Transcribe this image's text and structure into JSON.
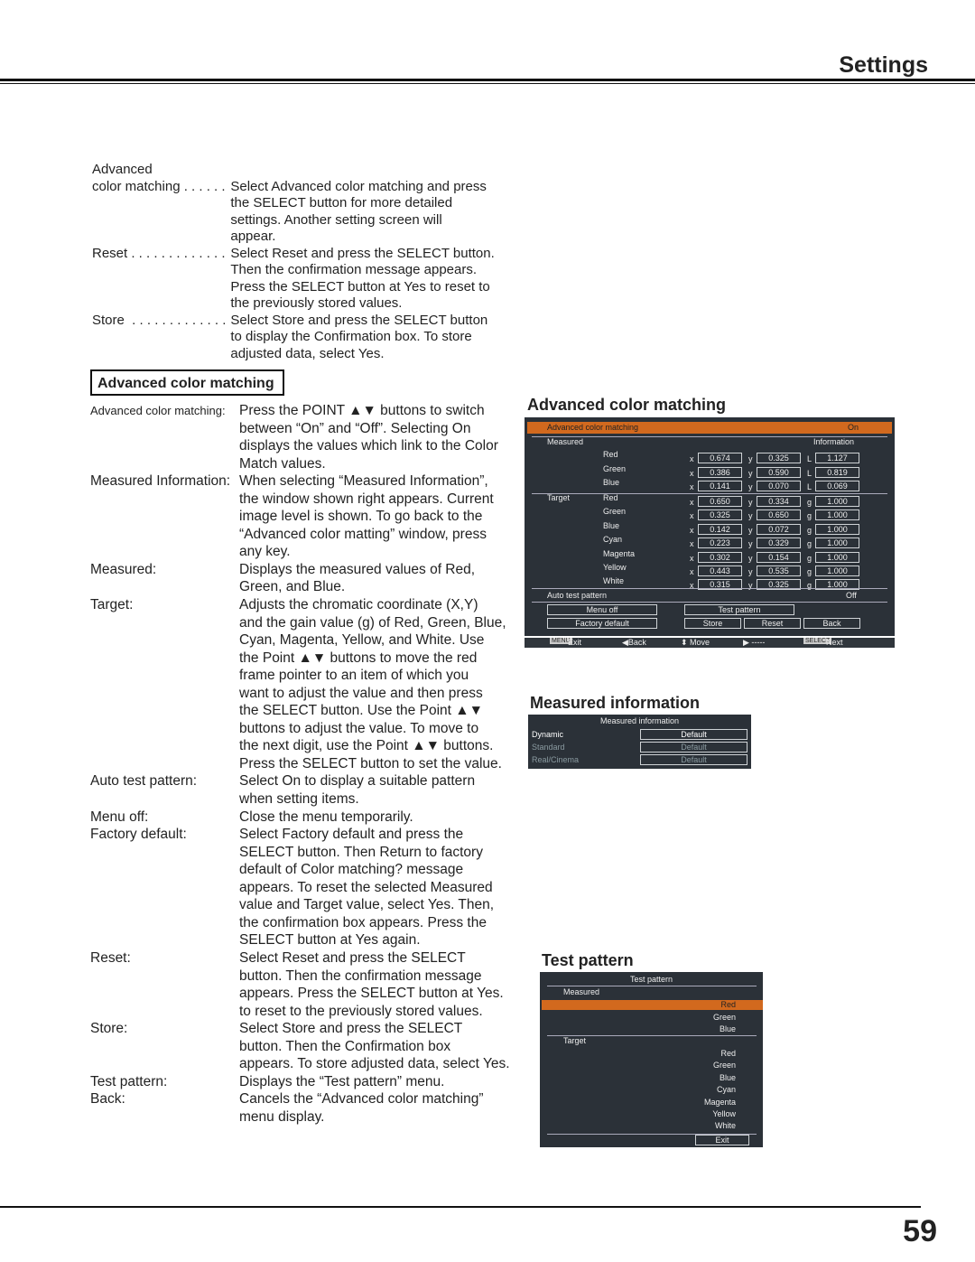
{
  "header": {
    "title": "Settings"
  },
  "top_definitions": [
    {
      "term": "Advanced",
      "lines": [
        ""
      ]
    },
    {
      "term": "color matching . . . . . .",
      "lines": [
        "Select Advanced color matching and press",
        "the SELECT button for more detailed",
        "settings. Another setting screen will",
        "appear."
      ]
    },
    {
      "term": "Reset . . . . . . . . . . . . .",
      "lines": [
        "Select Reset and press the SELECT button.",
        "Then the confirmation message appears.",
        "Press the SELECT button at Yes to reset to",
        "the previously stored values."
      ]
    },
    {
      "term": "Store  . . . . . . . . . . . . .",
      "lines": [
        "Select Store and press the SELECT button",
        "to display the Confirmation box. To store",
        "adjusted data, select Yes."
      ]
    }
  ],
  "section_title": "Advanced color matching",
  "definitions": [
    {
      "term": "Advanced color matching:",
      "small": true,
      "lines": [
        "Press the POINT ▲▼ buttons to switch",
        "between “On” and “Off”. Selecting On",
        "displays the values which link to the Color",
        "Match values."
      ]
    },
    {
      "term": "Measured Information:",
      "lines": [
        "When selecting “Measured Information”,",
        "the window shown right appears. Current",
        "image level is shown. To go back to the",
        "“Advanced color matting” window, press",
        "any key."
      ]
    },
    {
      "term": "Measured:",
      "lines": [
        "Displays the measured values of Red,",
        "Green, and Blue."
      ]
    },
    {
      "term": "Target:",
      "lines": [
        "Adjusts the chromatic coordinate (X,Y)",
        "and the gain value (g) of Red, Green, Blue,",
        "Cyan, Magenta, Yellow, and White. Use",
        "the Point ▲▼ buttons to move the red",
        "frame pointer to an item of which you",
        "want to adjust the value and then press",
        "the SELECT button. Use the Point ▲▼",
        "buttons to adjust the value. To move to",
        "the next digit, use the Point ▲▼ buttons.",
        "Press the SELECT button to set the value."
      ]
    },
    {
      "term": "Auto test pattern:",
      "lines": [
        "Select On to display a suitable pattern",
        "when setting items."
      ]
    },
    {
      "term": "Menu off:",
      "lines": [
        "Close the menu temporarily."
      ]
    },
    {
      "term": "Factory default:",
      "lines": [
        "Select Factory default and press the",
        "SELECT button. Then Return to factory",
        "default of Color matching? message",
        "appears. To reset the selected Measured",
        "value and Target value, select Yes. Then,",
        "the confirmation box appears. Press the",
        "SELECT button at Yes again."
      ]
    },
    {
      "term": "Reset:",
      "lines": [
        "Select Reset and press the SELECT",
        "button. Then the confirmation message",
        "appears. Press the SELECT button at Yes.",
        "to reset to the previously stored values."
      ]
    },
    {
      "term": "Store:",
      "lines": [
        "Select Store and press the SELECT",
        "button. Then the Confirmation box",
        "appears. To store adjusted data, select Yes."
      ]
    },
    {
      "term": "Test pattern:",
      "lines": [
        "Displays the “Test pattern” menu."
      ]
    },
    {
      "term": "Back:",
      "lines": [
        "Cancels the “Advanced color matching”",
        "menu display."
      ]
    }
  ],
  "acm_panel": {
    "heading": "Advanced color matching",
    "title": "Advanced color matching",
    "title_value": "On",
    "measured_label": "Measured",
    "information_label": "Information",
    "target_label": "Target",
    "measured": [
      {
        "name": "Red",
        "x": "0.674",
        "y": "0.325",
        "k": "L",
        "v": "1.127"
      },
      {
        "name": "Green",
        "x": "0.386",
        "y": "0.590",
        "k": "L",
        "v": "0.819"
      },
      {
        "name": "Blue",
        "x": "0.141",
        "y": "0.070",
        "k": "L",
        "v": "0.069"
      }
    ],
    "target": [
      {
        "name": "Red",
        "x": "0.650",
        "y": "0.334",
        "k": "g",
        "v": "1.000"
      },
      {
        "name": "Green",
        "x": "0.325",
        "y": "0.650",
        "k": "g",
        "v": "1.000"
      },
      {
        "name": "Blue",
        "x": "0.142",
        "y": "0.072",
        "k": "g",
        "v": "1.000"
      },
      {
        "name": "Cyan",
        "x": "0.223",
        "y": "0.329",
        "k": "g",
        "v": "1.000"
      },
      {
        "name": "Magenta",
        "x": "0.302",
        "y": "0.154",
        "k": "g",
        "v": "1.000"
      },
      {
        "name": "Yellow",
        "x": "0.443",
        "y": "0.535",
        "k": "g",
        "v": "1.000"
      },
      {
        "name": "White",
        "x": "0.315",
        "y": "0.325",
        "k": "g",
        "v": "1.000"
      }
    ],
    "auto_test_pattern": "Auto test pattern",
    "auto_test_value": "Off",
    "buttons": {
      "menu_off": "Menu off",
      "test_pattern": "Test pattern",
      "factory_default": "Factory default",
      "store": "Store",
      "reset": "Reset",
      "back": "Back"
    },
    "footer": {
      "menu": "MENU",
      "exit": "Exit",
      "back": "◀Back",
      "move": "⬍ Move",
      "next_arrow": "▶ -----",
      "select": "SELECT",
      "next": "Next"
    },
    "highlight_color": "#d2691e"
  },
  "mi_panel": {
    "heading": "Measured information",
    "title": "Measured information",
    "rows": [
      {
        "label": "Dynamic",
        "value": "Default",
        "active": true
      },
      {
        "label": "Standard",
        "value": "Default",
        "active": false
      },
      {
        "label": "Real/Cinema",
        "value": "Default",
        "active": false
      }
    ]
  },
  "tp_panel": {
    "heading": "Test pattern",
    "title": "Test pattern",
    "measured_label": "Measured",
    "target_label": "Target",
    "measured": [
      "Red",
      "Green",
      "Blue"
    ],
    "target": [
      "Red",
      "Green",
      "Blue",
      "Cyan",
      "Magenta",
      "Yellow",
      "White"
    ],
    "exit": "Exit"
  },
  "page_number": "59"
}
